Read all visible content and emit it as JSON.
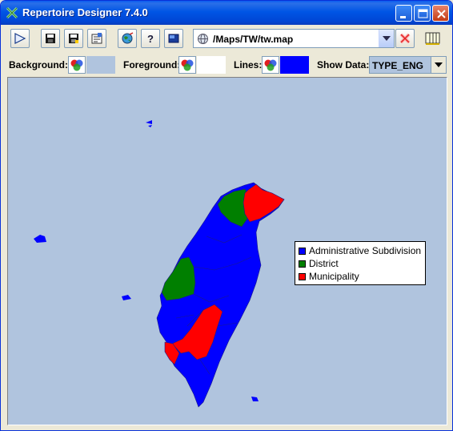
{
  "window": {
    "title": "Repertoire Designer 7.4.0"
  },
  "toolbar": {
    "map_path": "/Maps/TW/tw.map",
    "buttons": [
      "play-icon",
      "save-icon",
      "save-as-icon",
      "properties-icon",
      "globe-icon",
      "help-icon",
      "layer-icon"
    ]
  },
  "properties": {
    "background_label": "Background:",
    "foreground_label": "Foreground:",
    "lines_label": "Lines:",
    "show_data_label": "Show Data:",
    "show_data_value": "TYPE_ENG",
    "background_color": "#b0c4de",
    "foreground_color": "#ffffff",
    "lines_color": "#0000ff"
  },
  "legend": {
    "items": [
      {
        "label": "Administrative Subdivision",
        "color": "#0000ff"
      },
      {
        "label": "District",
        "color": "#007f00"
      },
      {
        "label": "Municipality",
        "color": "#ff0000"
      }
    ]
  }
}
